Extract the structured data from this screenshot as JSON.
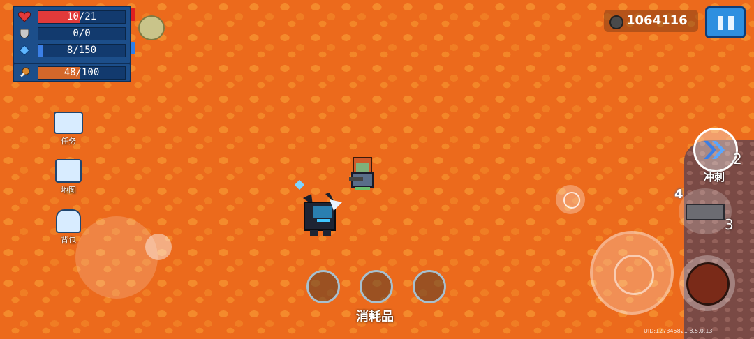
{
  "stats": {
    "health": {
      "text": "10/21",
      "value": 10,
      "max": 21,
      "color": "#e23a3a"
    },
    "armor": {
      "text": "0/0",
      "value": 0,
      "max": 0,
      "color": "#b8b8b8"
    },
    "energy": {
      "text": "8/150",
      "value": 8,
      "max": 150,
      "color": "#3b7fe6"
    },
    "hunger": {
      "text": "48/100",
      "value": 48,
      "max": 100,
      "color": "#d4672a"
    }
  },
  "currency": {
    "value": "1064116",
    "icon": "gem-coin-icon"
  },
  "side_menu": [
    {
      "label": "任务",
      "icon": "quest-board-icon"
    },
    {
      "label": "地图",
      "icon": "map-icon"
    },
    {
      "label": "背包",
      "icon": "backpack-icon"
    }
  ],
  "consumables": {
    "label": "消耗品",
    "slots": 3
  },
  "skills": {
    "dash": {
      "label": "冲刺",
      "count": "2"
    },
    "weapon": {
      "energy_cost": "4",
      "ammo": "3"
    }
  },
  "uid": "UID:127345821 8.5.0.13",
  "colors": {
    "lava": "#ec6a1c",
    "panel": "#1c4e8a",
    "accent": "#2e8fe0"
  }
}
